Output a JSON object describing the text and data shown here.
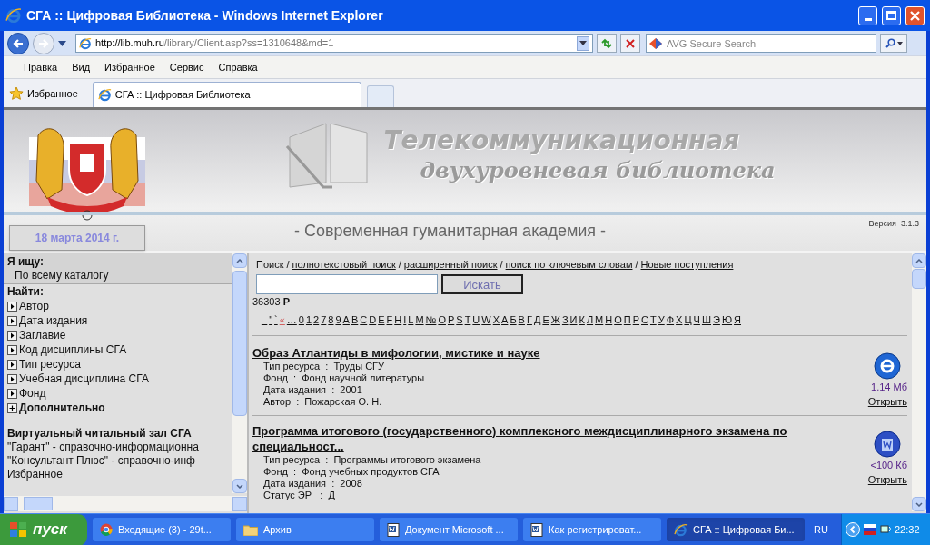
{
  "window": {
    "title": "СГА :: Цифровая Библиотека - Windows Internet Explorer"
  },
  "address_bar": {
    "url_host": "http://lib.muh.ru",
    "url_path": "/library/Client.asp?ss=1310648&md=1"
  },
  "search_box": {
    "placeholder": "AVG Secure Search"
  },
  "menu": [
    "Правка",
    "Вид",
    "Избранное",
    "Сервис",
    "Справка"
  ],
  "favorites": {
    "label": "Избранное"
  },
  "tabs": [
    {
      "label": "СГА :: Цифровая Библиотека",
      "selected": true
    }
  ],
  "header": {
    "banner_line_1": "Телекоммуникационная",
    "banner_line_2": "двухуровневая библиотека",
    "date": "18 марта 2014 г.",
    "academy": "- Современная гуманитарная академия -",
    "version_label": "Версия",
    "version": "3.1.3"
  },
  "sidebar": {
    "looking_for_label": "Я ищу:",
    "looking_for_value": "По всему каталогу",
    "find_label": "Найти:",
    "items": [
      {
        "label": "Автор",
        "kind": "arrow"
      },
      {
        "label": "Дата издания",
        "kind": "arrow"
      },
      {
        "label": "Заглавие",
        "kind": "arrow"
      },
      {
        "label": "Код дисциплины СГА",
        "kind": "arrow"
      },
      {
        "label": "Тип ресурса",
        "kind": "arrow"
      },
      {
        "label": "Учебная дисциплина СГА",
        "kind": "arrow"
      },
      {
        "label": "Фонд",
        "kind": "arrow"
      },
      {
        "label": "Дополнительно",
        "kind": "plus"
      }
    ],
    "section_title": "Виртуальный читальный зал СГА",
    "links": [
      "\"Гарант\" - справочно-информационна",
      "\"Консультант Плюс\" - справочно-инф",
      "Избранное"
    ]
  },
  "search": {
    "nav": [
      {
        "label": "Поиск",
        "kind": "text"
      },
      {
        "label": "/",
        "kind": "separator"
      },
      {
        "label": "полнотекстовый поиск",
        "kind": "link"
      },
      {
        "label": "/",
        "kind": "separator"
      },
      {
        "label": "расширенный поиск",
        "kind": "link"
      },
      {
        "label": "/",
        "kind": "separator"
      },
      {
        "label": "поиск по ключевым словам",
        "kind": "link"
      },
      {
        "label": "/",
        "kind": "separator"
      },
      {
        "label": "Новые поступления",
        "kind": "link"
      }
    ],
    "button": "Искать",
    "count": "36303",
    "count_suffix": "Р",
    "alphabet": [
      "_",
      "\"",
      "`",
      "«",
      "…",
      "0",
      "1",
      "2",
      "7",
      "8",
      "9",
      "A",
      "B",
      "C",
      "D",
      "E",
      "F",
      "H",
      "I",
      "L",
      "M",
      "№",
      "O",
      "P",
      "S",
      "T",
      "U",
      "W",
      "X",
      "А",
      "Б",
      "В",
      "Г",
      "Д",
      "Е",
      "Ж",
      "З",
      "И",
      "К",
      "Л",
      "М",
      "Н",
      "О",
      "П",
      "Р",
      "С",
      "Т",
      "У",
      "Ф",
      "Х",
      "Ц",
      "Ч",
      "Ш",
      "Э",
      "Ю",
      "Я"
    ]
  },
  "results": [
    {
      "title": "Образ Атлантиды в мифологии, мистике и науке",
      "kind": "web",
      "size": "1.14 Мб",
      "open": "Открыть",
      "fields": [
        "Тип ресурса  :  Труды СГУ",
        "Фонд  :  Фонд научной литературы",
        "Дата издания  :  2001",
        "Автор  :  Пожарская О. Н."
      ]
    },
    {
      "title": "Программа итогового (государственного) комплексного междисциплинарного экзамена по специальност...",
      "kind": "doc",
      "size": "<100 Кб",
      "open": "Открыть",
      "fields": [
        "Тип ресурса  :  Программы итогового экзамена",
        "Фонд  :  Фонд учебных продуктов СГА",
        "Дата издания  :  2008",
        "Статус ЭР   :  Д"
      ]
    }
  ],
  "taskbar": {
    "start": "пуск",
    "items": [
      {
        "label": "Входящие (3) - 29t...",
        "kind": "chrome",
        "selected": false
      },
      {
        "label": "Архив",
        "kind": "folder",
        "selected": false
      },
      {
        "label": "Документ Microsoft ...",
        "kind": "word",
        "selected": false
      },
      {
        "label": "Как регистрироват...",
        "kind": "word",
        "selected": false
      },
      {
        "label": "СГА :: Цифровая Би...",
        "kind": "ie",
        "selected": true
      }
    ],
    "lang": "RU",
    "time": "22:32"
  }
}
